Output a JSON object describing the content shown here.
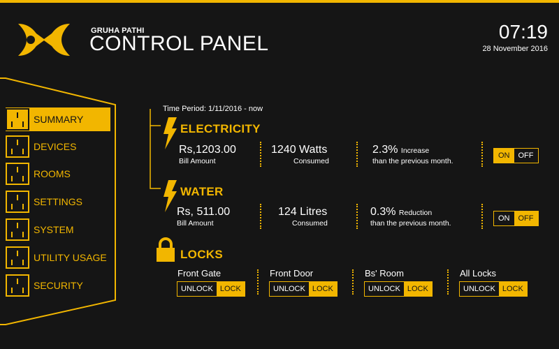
{
  "header": {
    "brand_small": "GRUHA PATHI",
    "brand_big": "CONTROL PANEL",
    "time": "07:19",
    "date": "28 November 2016"
  },
  "sidebar": {
    "items": [
      {
        "label": "SUMMARY",
        "active": true
      },
      {
        "label": "DEVICES"
      },
      {
        "label": "ROOMS"
      },
      {
        "label": "SETTINGS"
      },
      {
        "label": "SYSTEM"
      },
      {
        "label": "UTILITY USAGE"
      },
      {
        "label": "SECURITY"
      }
    ]
  },
  "summary": {
    "time_period": "Time Period: 1/11/2016 - now",
    "electricity": {
      "title": "ELECTRICITY",
      "bill_value": "Rs,1203.00",
      "bill_label": "Bill Amount",
      "consumed_value": "1240 Watts",
      "consumed_label": "Consumed",
      "change_pct": "2.3%",
      "change_word": "Increase",
      "change_desc": "than the previous month.",
      "toggle_on": "ON",
      "toggle_off": "OFF",
      "state": "ON"
    },
    "water": {
      "title": "WATER",
      "bill_value": "Rs, 511.00",
      "bill_label": "Bill Amount",
      "consumed_value": "124 Litres",
      "consumed_label": "Consumed",
      "change_pct": "0.3%",
      "change_word": "Reduction",
      "change_desc": "than the previous month.",
      "toggle_on": "ON",
      "toggle_off": "OFF",
      "state": "OFF"
    },
    "locks": {
      "title": "LOCKS",
      "items": [
        {
          "name": "Front Gate",
          "unlock": "UNLOCK",
          "lock": "LOCK"
        },
        {
          "name": "Front Door",
          "unlock": "UNLOCK",
          "lock": "LOCK"
        },
        {
          "name": "Bs' Room",
          "unlock": "UNLOCK",
          "lock": "LOCK"
        },
        {
          "name": "All Locks",
          "unlock": "UNLOCK",
          "lock": "LOCK"
        }
      ]
    }
  },
  "colors": {
    "accent": "#f2b600",
    "background": "#151515",
    "text": "#ffffff"
  }
}
